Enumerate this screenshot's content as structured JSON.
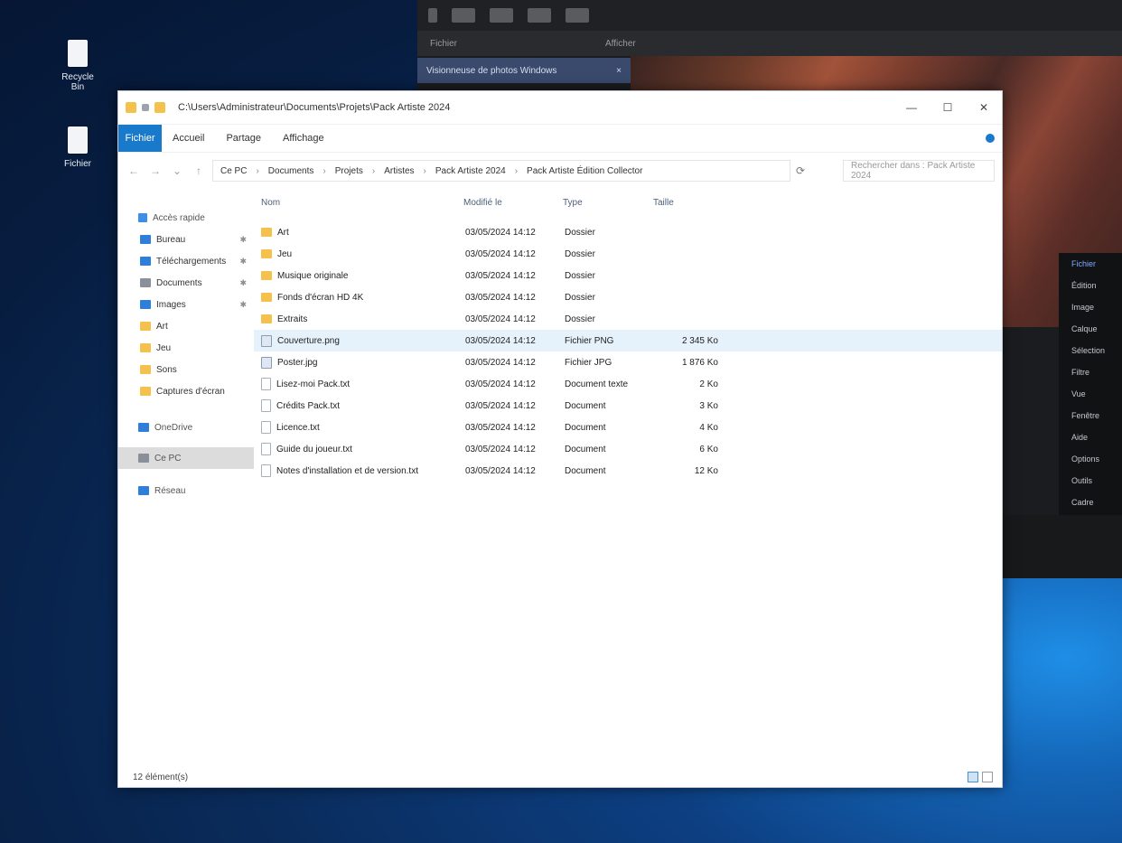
{
  "desktop": {
    "icons": [
      {
        "label": "Recycle Bin",
        "icon": "recycle-bin-icon"
      },
      {
        "label": "Fichier",
        "icon": "file-icon"
      }
    ]
  },
  "media_window": {
    "tab_label": "Visionneuse de photos Windows",
    "tab_close": "×",
    "menu": [
      "Fichier",
      "Afficher"
    ],
    "side_items": [
      "Fichier",
      "Édition",
      "Image",
      "Calque",
      "Sélection",
      "Filtre",
      "Vue",
      "Fenêtre",
      "Aide",
      "Options",
      "Outils",
      "Cadre"
    ]
  },
  "explorer": {
    "title": "C:\\Users\\Administrateur\\Documents\\Projets\\Pack Artiste 2024",
    "controls": {
      "minimize": "—",
      "maximize": "☐",
      "close": "✕"
    },
    "ribbon_tabs": [
      "Fichier",
      "Accueil",
      "Partage",
      "Affichage"
    ],
    "nav_buttons": {
      "back": "←",
      "forward": "→",
      "up": "↑",
      "recent": "⌄"
    },
    "breadcrumb": [
      "Ce PC",
      "Documents",
      "Projets",
      "Artistes",
      "Pack Artiste 2024",
      "Pack Artiste Édition Collector"
    ],
    "search_placeholder": "Rechercher dans : Pack Artiste 2024",
    "refresh": "⟳",
    "nav_pane": [
      {
        "label": "Accès rapide",
        "kind": "head",
        "icon": "star-icon"
      },
      {
        "label": "Bureau",
        "kind": "pinned",
        "icon": "desktop-icon",
        "pin": "📌"
      },
      {
        "label": "Téléchargements",
        "kind": "pinned",
        "icon": "download-icon",
        "pin": "📌"
      },
      {
        "label": "Documents",
        "kind": "pinned",
        "icon": "documents-icon",
        "pin": "📌"
      },
      {
        "label": "Images",
        "kind": "pinned",
        "icon": "pictures-icon",
        "pin": "📌"
      },
      {
        "label": "Art",
        "kind": "folder",
        "icon": "folder-icon"
      },
      {
        "label": "Jeu",
        "kind": "folder",
        "icon": "folder-icon"
      },
      {
        "label": "Sons",
        "kind": "folder",
        "icon": "folder-icon"
      },
      {
        "label": "Captures d'écran",
        "kind": "folder",
        "icon": "folder-icon"
      },
      {
        "label": "OneDrive",
        "kind": "section",
        "icon": "cloud-icon"
      },
      {
        "label": "Ce PC",
        "kind": "section-selected",
        "icon": "computer-icon"
      },
      {
        "label": "Réseau",
        "kind": "section",
        "icon": "network-icon"
      }
    ],
    "columns": {
      "name": "Nom",
      "date": "Modifié le",
      "type": "Type",
      "size": "Taille"
    },
    "files": [
      {
        "name": "Art",
        "date": "03/05/2024 14:12",
        "type": "Dossier",
        "size": "",
        "icon": "folder"
      },
      {
        "name": "Jeu",
        "date": "03/05/2024 14:12",
        "type": "Dossier",
        "size": "",
        "icon": "folder"
      },
      {
        "name": "Musique originale",
        "date": "03/05/2024 14:12",
        "type": "Dossier",
        "size": "",
        "icon": "folder"
      },
      {
        "name": "Fonds d'écran HD 4K",
        "date": "03/05/2024 14:12",
        "type": "Dossier",
        "size": "",
        "icon": "folder"
      },
      {
        "name": "Extraits",
        "date": "03/05/2024 14:12",
        "type": "Dossier",
        "size": "",
        "icon": "folder"
      },
      {
        "name": "Couverture.png",
        "date": "03/05/2024 14:12",
        "type": "Fichier PNG",
        "size": "2 345 Ko",
        "icon": "img",
        "selected": true
      },
      {
        "name": "Poster.jpg",
        "date": "03/05/2024 14:12",
        "type": "Fichier JPG",
        "size": "1 876 Ko",
        "icon": "img"
      },
      {
        "name": "Lisez-moi Pack.txt",
        "date": "03/05/2024 14:12",
        "type": "Document texte",
        "size": "2 Ko",
        "icon": "file"
      },
      {
        "name": "Crédits Pack.txt",
        "date": "03/05/2024 14:12",
        "type": "Document",
        "size": "3 Ko",
        "icon": "file"
      },
      {
        "name": "Licence.txt",
        "date": "03/05/2024 14:12",
        "type": "Document",
        "size": "4 Ko",
        "icon": "file"
      },
      {
        "name": "Guide du joueur.txt",
        "date": "03/05/2024 14:12",
        "type": "Document",
        "size": "6 Ko",
        "icon": "file"
      },
      {
        "name": "Notes d'installation et de version.txt",
        "date": "03/05/2024 14:12",
        "type": "Document",
        "size": "12 Ko",
        "icon": "file"
      }
    ],
    "status_text": "12 élément(s)",
    "colors": {
      "accent": "#1979ca",
      "folder": "#f3c14c",
      "selection": "#e5f1fb"
    }
  }
}
